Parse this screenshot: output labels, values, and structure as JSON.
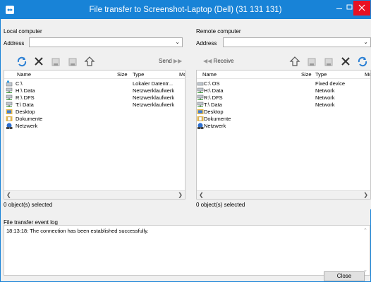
{
  "window": {
    "title": "File transfer to Screenshot-Laptop (Dell) (31 131 131)",
    "titlebar_color": "#1883d7",
    "close_color": "#e81123"
  },
  "local": {
    "label": "Local computer",
    "address_label": "Address",
    "address_value": "",
    "send_label": "Send",
    "columns": [
      "Name",
      "Size",
      "Type",
      "Mod"
    ],
    "rows": [
      {
        "name": "C:\\",
        "size": "",
        "type": "Lokaler Datentr...",
        "icon": "drive-icon"
      },
      {
        "name": "H:\\ Data",
        "size": "",
        "type": "Netzwerklaufwerk",
        "icon": "network-drive-icon"
      },
      {
        "name": "R:\\ DFS",
        "size": "",
        "type": "Netzwerklaufwerk",
        "icon": "network-drive-icon"
      },
      {
        "name": "T:\\ Data",
        "size": "",
        "type": "Netzwerklaufwerk",
        "icon": "network-drive-icon"
      },
      {
        "name": "Desktop",
        "size": "",
        "type": "",
        "icon": "desktop-folder-icon"
      },
      {
        "name": "Dokumente",
        "size": "",
        "type": "",
        "icon": "documents-folder-icon"
      },
      {
        "name": "Netzwerk",
        "size": "",
        "type": "",
        "icon": "network-icon"
      }
    ],
    "status": "0 object(s) selected"
  },
  "remote": {
    "label": "Remote computer",
    "address_label": "Address",
    "address_value": "",
    "receive_label": "Receive",
    "columns": [
      "Name",
      "Size",
      "Type",
      "Mo"
    ],
    "rows": [
      {
        "name": "C:\\ OS",
        "size": "",
        "type": "Fixed device",
        "icon": "drive-icon"
      },
      {
        "name": "H:\\ Data",
        "size": "",
        "type": "Network",
        "icon": "network-drive-icon"
      },
      {
        "name": "R:\\ DFS",
        "size": "",
        "type": "Network",
        "icon": "network-drive-icon"
      },
      {
        "name": "T:\\ Data",
        "size": "",
        "type": "Network",
        "icon": "network-drive-icon"
      },
      {
        "name": "Desktop",
        "size": "",
        "type": "",
        "icon": "desktop-folder-icon"
      },
      {
        "name": "Dokumente",
        "size": "",
        "type": "",
        "icon": "documents-folder-icon"
      },
      {
        "name": "Netzwerk",
        "size": "",
        "type": "",
        "icon": "network-icon"
      }
    ],
    "status": "0 object(s) selected"
  },
  "log": {
    "label": "File transfer event log",
    "lines": [
      "18:13:18: The connection has been established successfully."
    ]
  },
  "footer": {
    "close_label": "Close"
  }
}
